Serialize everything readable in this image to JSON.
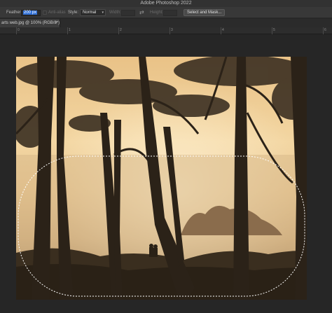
{
  "app": {
    "title": "Adobe Photoshop 2022"
  },
  "options_bar": {
    "feather_label": "Feather:",
    "feather_value": "200 px",
    "antialias_label": "Anti-alias",
    "style_label": "Style:",
    "style_value": "Normal",
    "width_label": "Width:",
    "height_label": "Height:",
    "swap_icon": "swap-arrows-icon",
    "select_mask_label": "Select and Mask..."
  },
  "document": {
    "tab_label": "arts web.jpg @ 100% (RGB/8*)",
    "close_symbol": "×"
  },
  "ruler": {
    "marks": [
      "0",
      "1",
      "2",
      "3",
      "4",
      "5",
      "6"
    ]
  },
  "colors": {
    "accent": "#2f6fd6",
    "sky": "#f0c98a",
    "canvas": "#262626"
  }
}
